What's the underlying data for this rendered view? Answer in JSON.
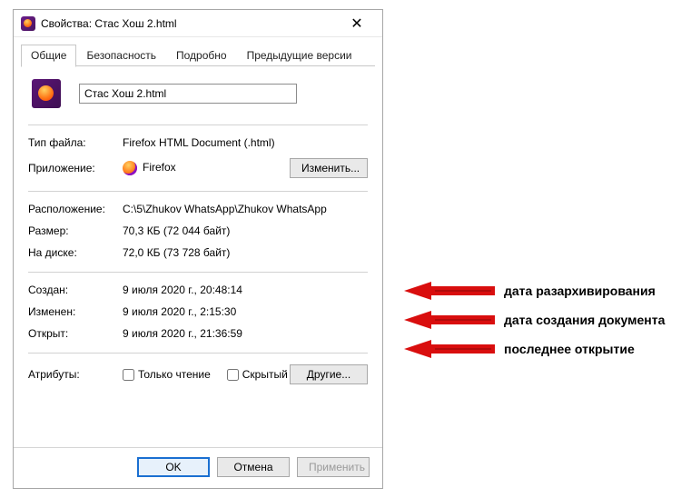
{
  "window": {
    "title": "Свойства: Стас Хош 2.html"
  },
  "tabs": {
    "general": "Общие",
    "security": "Безопасность",
    "details": "Подробно",
    "previous": "Предыдущие версии"
  },
  "file": {
    "name": "Стас Хош 2.html"
  },
  "labels": {
    "filetype": "Тип файла:",
    "app": "Приложение:",
    "change_btn": "Изменить...",
    "location": "Расположение:",
    "size": "Размер:",
    "ondisk": "На диске:",
    "created": "Создан:",
    "modified": "Изменен:",
    "accessed": "Открыт:",
    "attributes": "Атрибуты:",
    "readonly": "Только чтение",
    "hidden": "Скрытый",
    "other_btn": "Другие..."
  },
  "values": {
    "filetype": "Firefox HTML Document (.html)",
    "app_name": "Firefox",
    "location": "C:\\5\\Zhukov WhatsApp\\Zhukov WhatsApp",
    "size": "70,3 КБ (72 044 байт)",
    "ondisk": "72,0 КБ (73 728 байт)",
    "created": "9 июля 2020 г., 20:48:14",
    "modified": "9 июля 2020 г., 2:15:30",
    "accessed": "9 июля 2020 г., 21:36:59"
  },
  "buttons": {
    "ok": "OK",
    "cancel": "Отмена",
    "apply": "Применить"
  },
  "annotations": {
    "created": "дата разархивирования",
    "modified": "дата создания документа",
    "accessed": "последнее открытие"
  },
  "colors": {
    "arrow": "#d90e0e"
  }
}
